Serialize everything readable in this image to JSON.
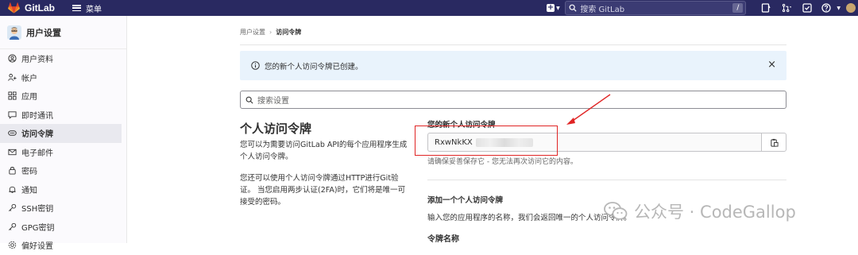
{
  "topbar": {
    "brand": "GitLab",
    "menu_label": "菜单",
    "search_placeholder": "搜索 GitLab",
    "search_shortcut": "/"
  },
  "sidebar": {
    "title": "用户设置",
    "items": [
      {
        "label": "用户资料",
        "icon": "profile-icon"
      },
      {
        "label": "帐户",
        "icon": "account-icon"
      },
      {
        "label": "应用",
        "icon": "applications-icon"
      },
      {
        "label": "即时通讯",
        "icon": "chat-icon"
      },
      {
        "label": "访问令牌",
        "icon": "token-icon",
        "active": true
      },
      {
        "label": "电子邮件",
        "icon": "mail-icon"
      },
      {
        "label": "密码",
        "icon": "lock-icon"
      },
      {
        "label": "通知",
        "icon": "bell-icon"
      },
      {
        "label": "SSH密钥",
        "icon": "key-icon"
      },
      {
        "label": "GPG密钥",
        "icon": "key-icon"
      },
      {
        "label": "偏好设置",
        "icon": "preferences-icon"
      }
    ]
  },
  "breadcrumb": {
    "parent": "用户设置",
    "current": "访问令牌"
  },
  "alert": {
    "message": "您的新个人访问令牌已创建。",
    "close": "×"
  },
  "settings_search": {
    "placeholder": "搜索设置"
  },
  "section": {
    "title": "个人访问令牌",
    "desc1": "您可以为需要访问GitLab API的每个应用程序生成个人访问令牌。",
    "desc2": "您还可以使用个人访问令牌通过HTTP进行Git验证。 当您启用两步认证(2FA)时，它们将是唯一可接受的密码。"
  },
  "new_token": {
    "label": "您的新个人访问令牌",
    "value_visible": "RxwNkKX",
    "help": "请确保妥善保存它 - 您无法再次访问它的内容。"
  },
  "add_token": {
    "title": "添加一个个人访问令牌",
    "desc": "输入您的应用程序的名称，我们会返回唯一的个人访问令牌。",
    "name_label": "令牌名称"
  },
  "watermark": {
    "text": "公众号 · CodeGallop"
  },
  "colors": {
    "navbar": "#292961",
    "alert_bg": "#e9f3fc",
    "highlight": "#e02424"
  }
}
